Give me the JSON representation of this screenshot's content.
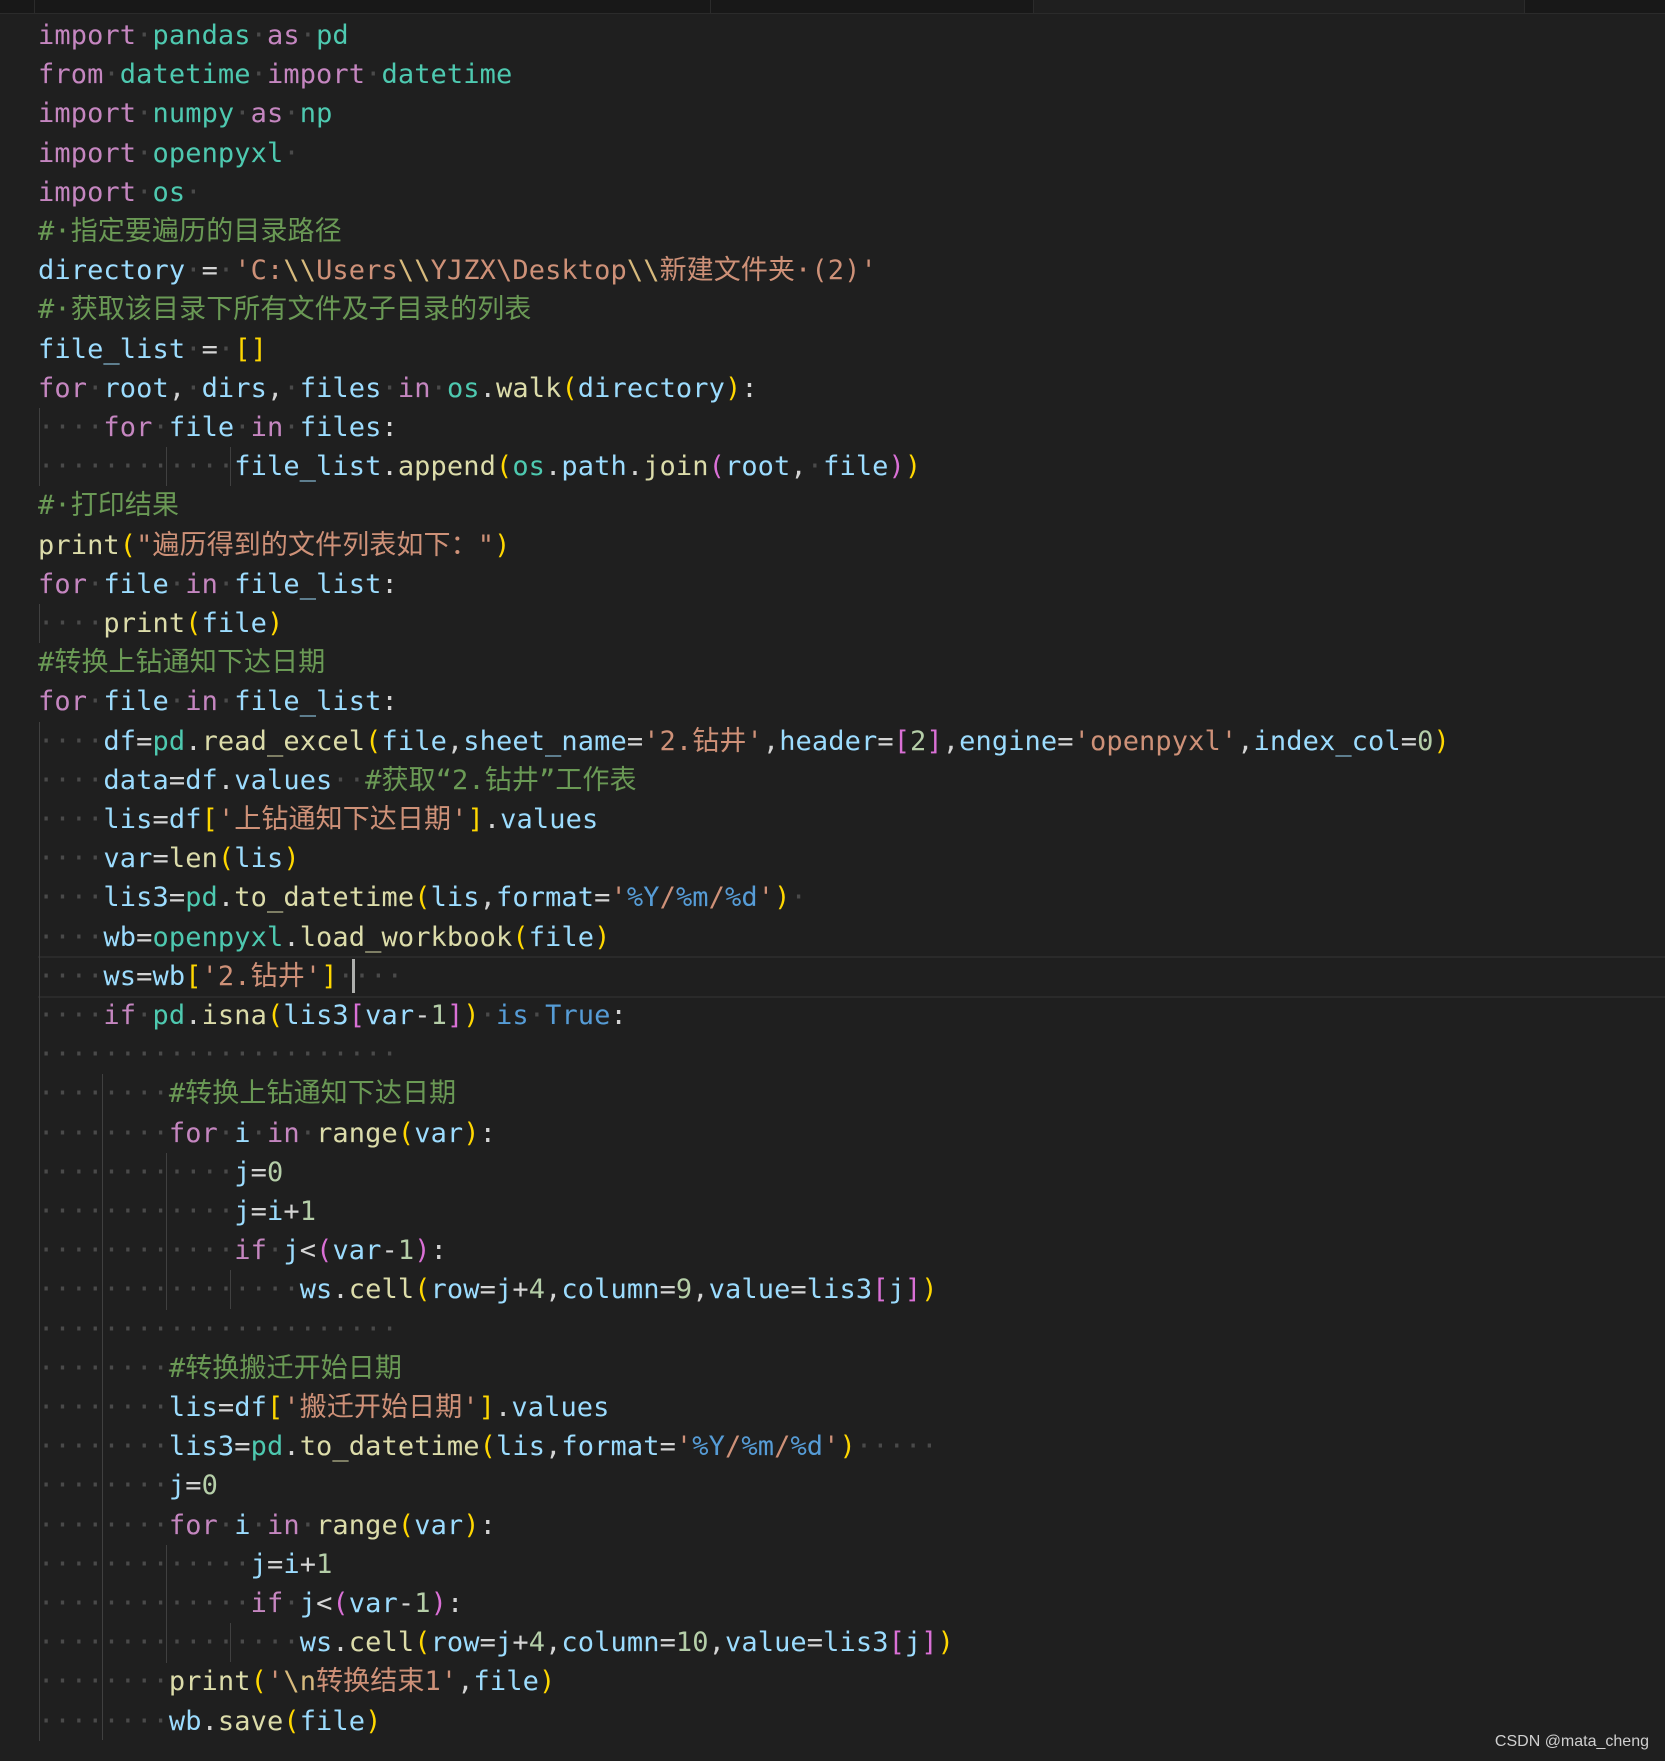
{
  "lines": [
    [
      [
        "kw",
        "import"
      ],
      [
        "ws",
        "·"
      ],
      [
        "mod",
        "pandas"
      ],
      [
        "ws",
        "·"
      ],
      [
        "kw",
        "as"
      ],
      [
        "ws",
        "·"
      ],
      [
        "mod",
        "pd"
      ]
    ],
    [
      [
        "kw",
        "from"
      ],
      [
        "ws",
        "·"
      ],
      [
        "mod",
        "datetime"
      ],
      [
        "ws",
        "·"
      ],
      [
        "kw",
        "import"
      ],
      [
        "ws",
        "·"
      ],
      [
        "mod",
        "datetime"
      ]
    ],
    [
      [
        "kw",
        "import"
      ],
      [
        "ws",
        "·"
      ],
      [
        "mod",
        "numpy"
      ],
      [
        "ws",
        "·"
      ],
      [
        "kw",
        "as"
      ],
      [
        "ws",
        "·"
      ],
      [
        "mod",
        "np"
      ]
    ],
    [
      [
        "kw",
        "import"
      ],
      [
        "ws",
        "·"
      ],
      [
        "mod",
        "openpyxl"
      ],
      [
        "ws",
        "·"
      ]
    ],
    [
      [
        "kw",
        "import"
      ],
      [
        "ws",
        "·"
      ],
      [
        "mod",
        "os"
      ],
      [
        "ws",
        "·"
      ]
    ],
    [
      [
        "cm",
        "#·指定要遍历的目录路径"
      ]
    ],
    [
      [
        "var",
        "directory"
      ],
      [
        "ws",
        "·"
      ],
      [
        "op",
        "="
      ],
      [
        "ws",
        "·"
      ],
      [
        "str",
        "'C:"
      ],
      [
        "esc",
        "\\\\"
      ],
      [
        "str",
        "Users"
      ],
      [
        "esc",
        "\\\\"
      ],
      [
        "str",
        "YJZX\\Desktop"
      ],
      [
        "esc",
        "\\\\"
      ],
      [
        "str",
        "新建文件夹·(2)'"
      ]
    ],
    [
      [
        "cm",
        "#·获取该目录下所有文件及子目录的列表"
      ]
    ],
    [
      [
        "var",
        "file_list"
      ],
      [
        "ws",
        "·"
      ],
      [
        "op",
        "="
      ],
      [
        "ws",
        "·"
      ],
      [
        "b1",
        "[]"
      ]
    ],
    [
      [
        "kw",
        "for"
      ],
      [
        "ws",
        "·"
      ],
      [
        "var",
        "root"
      ],
      [
        "op",
        ","
      ],
      [
        "ws",
        "·"
      ],
      [
        "var",
        "dirs"
      ],
      [
        "op",
        ","
      ],
      [
        "ws",
        "·"
      ],
      [
        "var",
        "files"
      ],
      [
        "ws",
        "·"
      ],
      [
        "kw",
        "in"
      ],
      [
        "ws",
        "·"
      ],
      [
        "mod",
        "os"
      ],
      [
        "op",
        "."
      ],
      [
        "fn",
        "walk"
      ],
      [
        "b1",
        "("
      ],
      [
        "var",
        "directory"
      ],
      [
        "b1",
        ")"
      ],
      [
        "op",
        ":"
      ]
    ],
    [
      [
        "ws",
        "····"
      ],
      [
        "kw",
        "for"
      ],
      [
        "ws",
        "·"
      ],
      [
        "var",
        "file"
      ],
      [
        "ws",
        "·"
      ],
      [
        "kw",
        "in"
      ],
      [
        "ws",
        "·"
      ],
      [
        "var",
        "files"
      ],
      [
        "op",
        ":"
      ]
    ],
    [
      [
        "ws",
        "············"
      ],
      [
        "var",
        "file_list"
      ],
      [
        "op",
        "."
      ],
      [
        "fn",
        "append"
      ],
      [
        "b1",
        "("
      ],
      [
        "mod",
        "os"
      ],
      [
        "op",
        "."
      ],
      [
        "var",
        "path"
      ],
      [
        "op",
        "."
      ],
      [
        "fn",
        "join"
      ],
      [
        "b2",
        "("
      ],
      [
        "var",
        "root"
      ],
      [
        "op",
        ","
      ],
      [
        "ws",
        "·"
      ],
      [
        "var",
        "file"
      ],
      [
        "b2",
        ")"
      ],
      [
        "b1",
        ")"
      ]
    ],
    [
      [
        "cm",
        "#·打印结果"
      ]
    ],
    [
      [
        "fn",
        "print"
      ],
      [
        "b1",
        "("
      ],
      [
        "str",
        "\"遍历得到的文件列表如下：\""
      ],
      [
        "b1",
        ")"
      ]
    ],
    [
      [
        "kw",
        "for"
      ],
      [
        "ws",
        "·"
      ],
      [
        "var",
        "file"
      ],
      [
        "ws",
        "·"
      ],
      [
        "kw",
        "in"
      ],
      [
        "ws",
        "·"
      ],
      [
        "var",
        "file_list"
      ],
      [
        "op",
        ":"
      ]
    ],
    [
      [
        "ws",
        "····"
      ],
      [
        "fn",
        "print"
      ],
      [
        "b1",
        "("
      ],
      [
        "var",
        "file"
      ],
      [
        "b1",
        ")"
      ]
    ],
    [
      [
        "cm",
        "#转换上钻通知下达日期"
      ]
    ],
    [
      [
        "kw",
        "for"
      ],
      [
        "ws",
        "·"
      ],
      [
        "var",
        "file"
      ],
      [
        "ws",
        "·"
      ],
      [
        "kw",
        "in"
      ],
      [
        "ws",
        "·"
      ],
      [
        "var",
        "file_list"
      ],
      [
        "op",
        ":"
      ]
    ],
    [
      [
        "ws",
        "····"
      ],
      [
        "var",
        "df"
      ],
      [
        "op",
        "="
      ],
      [
        "mod",
        "pd"
      ],
      [
        "op",
        "."
      ],
      [
        "fn",
        "read_excel"
      ],
      [
        "b1",
        "("
      ],
      [
        "var",
        "file"
      ],
      [
        "op",
        ","
      ],
      [
        "var",
        "sheet_name"
      ],
      [
        "op",
        "="
      ],
      [
        "str",
        "'2.钻井'"
      ],
      [
        "op",
        ","
      ],
      [
        "var",
        "header"
      ],
      [
        "op",
        "="
      ],
      [
        "b2",
        "["
      ],
      [
        "num",
        "2"
      ],
      [
        "b2",
        "]"
      ],
      [
        "op",
        ","
      ],
      [
        "var",
        "engine"
      ],
      [
        "op",
        "="
      ],
      [
        "str",
        "'openpyxl'"
      ],
      [
        "op",
        ","
      ],
      [
        "var",
        "index_col"
      ],
      [
        "op",
        "="
      ],
      [
        "num",
        "0"
      ],
      [
        "b1",
        ")"
      ]
    ],
    [
      [
        "ws",
        "····"
      ],
      [
        "var",
        "data"
      ],
      [
        "op",
        "="
      ],
      [
        "var",
        "df"
      ],
      [
        "op",
        "."
      ],
      [
        "var",
        "values"
      ],
      [
        "ws",
        "··"
      ],
      [
        "cm",
        "#获取“2.钻井”工作表"
      ]
    ],
    [
      [
        "ws",
        "····"
      ],
      [
        "var",
        "lis"
      ],
      [
        "op",
        "="
      ],
      [
        "var",
        "df"
      ],
      [
        "b1",
        "["
      ],
      [
        "str",
        "'上钻通知下达日期'"
      ],
      [
        "b1",
        "]"
      ],
      [
        "op",
        "."
      ],
      [
        "var",
        "values"
      ]
    ],
    [
      [
        "ws",
        "····"
      ],
      [
        "var",
        "var"
      ],
      [
        "op",
        "="
      ],
      [
        "fn",
        "len"
      ],
      [
        "b1",
        "("
      ],
      [
        "var",
        "lis"
      ],
      [
        "b1",
        ")"
      ]
    ],
    [
      [
        "ws",
        "····"
      ],
      [
        "var",
        "lis3"
      ],
      [
        "op",
        "="
      ],
      [
        "mod",
        "pd"
      ],
      [
        "op",
        "."
      ],
      [
        "fn",
        "to_datetime"
      ],
      [
        "b1",
        "("
      ],
      [
        "var",
        "lis"
      ],
      [
        "op",
        ","
      ],
      [
        "var",
        "format"
      ],
      [
        "op",
        "="
      ],
      [
        "str",
        "'"
      ],
      [
        "fmt",
        "%Y"
      ],
      [
        "str",
        "/"
      ],
      [
        "fmt",
        "%m"
      ],
      [
        "str",
        "/"
      ],
      [
        "fmt",
        "%d"
      ],
      [
        "str",
        "'"
      ],
      [
        "b1",
        ")"
      ],
      [
        "ws",
        "·"
      ]
    ],
    [
      [
        "ws",
        "····"
      ],
      [
        "var",
        "wb"
      ],
      [
        "op",
        "="
      ],
      [
        "mod",
        "openpyxl"
      ],
      [
        "op",
        "."
      ],
      [
        "fn",
        "load_workbook"
      ],
      [
        "b1",
        "("
      ],
      [
        "var",
        "file"
      ],
      [
        "b1",
        ")"
      ]
    ],
    [
      [
        "ws",
        "····"
      ],
      [
        "var",
        "ws"
      ],
      [
        "op",
        "="
      ],
      [
        "var",
        "wb"
      ],
      [
        "b1",
        "["
      ],
      [
        "str",
        "'2.钻井'"
      ],
      [
        "b1",
        "]"
      ],
      [
        "ws",
        "·"
      ],
      [
        "ws",
        "·"
      ],
      [
        "ws",
        "··"
      ]
    ],
    [
      [
        "ws",
        "····"
      ],
      [
        "kw",
        "if"
      ],
      [
        "ws",
        "·"
      ],
      [
        "mod",
        "pd"
      ],
      [
        "op",
        "."
      ],
      [
        "fn",
        "isna"
      ],
      [
        "b1",
        "("
      ],
      [
        "var",
        "lis3"
      ],
      [
        "b2",
        "["
      ],
      [
        "var",
        "var"
      ],
      [
        "op",
        "-"
      ],
      [
        "num",
        "1"
      ],
      [
        "b2",
        "]"
      ],
      [
        "b1",
        ")"
      ],
      [
        "ws",
        "·"
      ],
      [
        "bk",
        "is"
      ],
      [
        "ws",
        "·"
      ],
      [
        "bk",
        "True"
      ],
      [
        "op",
        ":"
      ]
    ],
    [
      [
        "ws",
        "······················"
      ]
    ],
    [
      [
        "ws",
        "········"
      ],
      [
        "cm",
        "#转换上钻通知下达日期"
      ]
    ],
    [
      [
        "ws",
        "········"
      ],
      [
        "kw",
        "for"
      ],
      [
        "ws",
        "·"
      ],
      [
        "var",
        "i"
      ],
      [
        "ws",
        "·"
      ],
      [
        "kw",
        "in"
      ],
      [
        "ws",
        "·"
      ],
      [
        "fn",
        "range"
      ],
      [
        "b1",
        "("
      ],
      [
        "var",
        "var"
      ],
      [
        "b1",
        ")"
      ],
      [
        "op",
        ":"
      ]
    ],
    [
      [
        "ws",
        "··········"
      ],
      [
        "ws",
        "··"
      ],
      [
        "var",
        "j"
      ],
      [
        "op",
        "="
      ],
      [
        "num",
        "0"
      ]
    ],
    [
      [
        "ws",
        "··········"
      ],
      [
        "ws",
        "··"
      ],
      [
        "var",
        "j"
      ],
      [
        "op",
        "="
      ],
      [
        "var",
        "i"
      ],
      [
        "op",
        "+"
      ],
      [
        "num",
        "1"
      ]
    ],
    [
      [
        "ws",
        "··········"
      ],
      [
        "ws",
        "··"
      ],
      [
        "kw",
        "if"
      ],
      [
        "ws",
        "·"
      ],
      [
        "var",
        "j"
      ],
      [
        "op",
        "<"
      ],
      [
        "b2",
        "("
      ],
      [
        "var",
        "var"
      ],
      [
        "op",
        "-"
      ],
      [
        "num",
        "1"
      ],
      [
        "b2",
        ")"
      ],
      [
        "op",
        ":"
      ]
    ],
    [
      [
        "ws",
        "················"
      ],
      [
        "var",
        "ws"
      ],
      [
        "op",
        "."
      ],
      [
        "fn",
        "cell"
      ],
      [
        "b1",
        "("
      ],
      [
        "var",
        "row"
      ],
      [
        "op",
        "="
      ],
      [
        "var",
        "j"
      ],
      [
        "op",
        "+"
      ],
      [
        "num",
        "4"
      ],
      [
        "op",
        ","
      ],
      [
        "var",
        "column"
      ],
      [
        "op",
        "="
      ],
      [
        "num",
        "9"
      ],
      [
        "op",
        ","
      ],
      [
        "var",
        "value"
      ],
      [
        "op",
        "="
      ],
      [
        "var",
        "lis3"
      ],
      [
        "b2",
        "["
      ],
      [
        "var",
        "j"
      ],
      [
        "b2",
        "]"
      ],
      [
        "b1",
        ")"
      ]
    ],
    [
      [
        "ws",
        "······················"
      ]
    ],
    [
      [
        "ws",
        "········"
      ],
      [
        "cm",
        "#转换搬迁开始日期"
      ]
    ],
    [
      [
        "ws",
        "········"
      ],
      [
        "var",
        "lis"
      ],
      [
        "op",
        "="
      ],
      [
        "var",
        "df"
      ],
      [
        "b1",
        "["
      ],
      [
        "str",
        "'搬迁开始日期'"
      ],
      [
        "b1",
        "]"
      ],
      [
        "op",
        "."
      ],
      [
        "var",
        "values"
      ]
    ],
    [
      [
        "ws",
        "········"
      ],
      [
        "var",
        "lis3"
      ],
      [
        "op",
        "="
      ],
      [
        "mod",
        "pd"
      ],
      [
        "op",
        "."
      ],
      [
        "fn",
        "to_datetime"
      ],
      [
        "b1",
        "("
      ],
      [
        "var",
        "lis"
      ],
      [
        "op",
        ","
      ],
      [
        "var",
        "format"
      ],
      [
        "op",
        "="
      ],
      [
        "str",
        "'"
      ],
      [
        "fmt",
        "%Y"
      ],
      [
        "str",
        "/"
      ],
      [
        "fmt",
        "%m"
      ],
      [
        "str",
        "/"
      ],
      [
        "fmt",
        "%d"
      ],
      [
        "str",
        "'"
      ],
      [
        "b1",
        ")"
      ],
      [
        "ws",
        "·····"
      ]
    ],
    [
      [
        "ws",
        "········"
      ],
      [
        "var",
        "j"
      ],
      [
        "op",
        "="
      ],
      [
        "num",
        "0"
      ]
    ],
    [
      [
        "ws",
        "········"
      ],
      [
        "kw",
        "for"
      ],
      [
        "ws",
        "·"
      ],
      [
        "var",
        "i"
      ],
      [
        "ws",
        "·"
      ],
      [
        "kw",
        "in"
      ],
      [
        "ws",
        "·"
      ],
      [
        "fn",
        "range"
      ],
      [
        "b1",
        "("
      ],
      [
        "var",
        "var"
      ],
      [
        "b1",
        ")"
      ],
      [
        "op",
        ":"
      ]
    ],
    [
      [
        "ws",
        "············"
      ],
      [
        "ws",
        "·"
      ],
      [
        "var",
        "j"
      ],
      [
        "op",
        "="
      ],
      [
        "var",
        "i"
      ],
      [
        "op",
        "+"
      ],
      [
        "num",
        "1"
      ]
    ],
    [
      [
        "ws",
        "············"
      ],
      [
        "ws",
        "·"
      ],
      [
        "kw",
        "if"
      ],
      [
        "ws",
        "·"
      ],
      [
        "var",
        "j"
      ],
      [
        "op",
        "<"
      ],
      [
        "b2",
        "("
      ],
      [
        "var",
        "var"
      ],
      [
        "op",
        "-"
      ],
      [
        "num",
        "1"
      ],
      [
        "b2",
        ")"
      ],
      [
        "op",
        ":"
      ]
    ],
    [
      [
        "ws",
        "················"
      ],
      [
        "var",
        "ws"
      ],
      [
        "op",
        "."
      ],
      [
        "fn",
        "cell"
      ],
      [
        "b1",
        "("
      ],
      [
        "var",
        "row"
      ],
      [
        "op",
        "="
      ],
      [
        "var",
        "j"
      ],
      [
        "op",
        "+"
      ],
      [
        "num",
        "4"
      ],
      [
        "op",
        ","
      ],
      [
        "var",
        "column"
      ],
      [
        "op",
        "="
      ],
      [
        "num",
        "10"
      ],
      [
        "op",
        ","
      ],
      [
        "var",
        "value"
      ],
      [
        "op",
        "="
      ],
      [
        "var",
        "lis3"
      ],
      [
        "b2",
        "["
      ],
      [
        "var",
        "j"
      ],
      [
        "b2",
        "]"
      ],
      [
        "b1",
        ")"
      ]
    ],
    [
      [
        "ws",
        "········"
      ],
      [
        "fn",
        "print"
      ],
      [
        "b1",
        "("
      ],
      [
        "str",
        "'"
      ],
      [
        "esc",
        "\\n"
      ],
      [
        "str",
        "转换结束1'"
      ],
      [
        "op",
        ","
      ],
      [
        "var",
        "file"
      ],
      [
        "b1",
        ")"
      ]
    ],
    [
      [
        "ws",
        "········"
      ],
      [
        "var",
        "wb"
      ],
      [
        "op",
        "."
      ],
      [
        "fn",
        "save"
      ],
      [
        "b1",
        "("
      ],
      [
        "var",
        "file"
      ],
      [
        "b1",
        ")"
      ]
    ]
  ],
  "current_line_index": 24,
  "watermark": "CSDN @mata_cheng",
  "colors": {
    "background": "#1f1f1f",
    "keyword": "#c586c0",
    "builtin_constant": "#569cd6",
    "module": "#4ec9b0",
    "function": "#dcdcaa",
    "variable": "#9cdcfe",
    "string": "#ce9178",
    "comment": "#6a9955",
    "number": "#b5cea8",
    "bracket1": "#ffd700",
    "bracket2": "#da70d6",
    "whitespace_marker": "#4a4a4a"
  }
}
